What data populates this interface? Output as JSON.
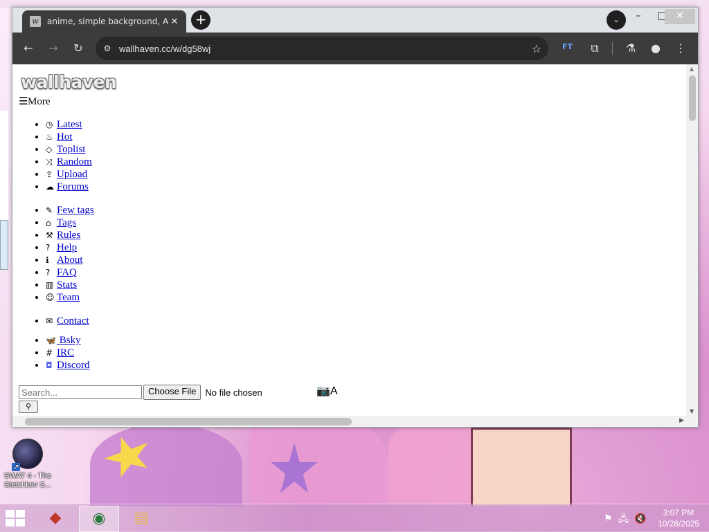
{
  "browser": {
    "tab_title": "anime, simple background, Asta",
    "tab_favicon": "wallhaven-favicon",
    "url": "wallhaven.cc/w/dg58wj",
    "extension_label": "FT"
  },
  "page": {
    "logo": "wallhaven",
    "more_label": "More",
    "nav_main": [
      {
        "icon": "clock-icon",
        "glyph": "◷",
        "label": "Latest"
      },
      {
        "icon": "flame-icon",
        "glyph": "♨",
        "label": "Hot"
      },
      {
        "icon": "diamond-icon",
        "glyph": "◇",
        "label": "Toplist"
      },
      {
        "icon": "shuffle-icon",
        "glyph": "⤨",
        "label": "Random"
      },
      {
        "icon": "upload-icon",
        "glyph": "⇪",
        "label": "Upload"
      },
      {
        "icon": "forums-icon",
        "glyph": "☁",
        "label": "Forums"
      }
    ],
    "nav_info": [
      {
        "icon": "tag-edit-icon",
        "glyph": "✎",
        "label": "Few tags"
      },
      {
        "icon": "tags-icon",
        "glyph": "⌂",
        "label": "Tags"
      },
      {
        "icon": "gavel-icon",
        "glyph": "⚒",
        "label": "Rules"
      },
      {
        "icon": "help-icon",
        "glyph": "?",
        "label": "Help"
      },
      {
        "icon": "info-icon",
        "glyph": "ℹ",
        "label": "About"
      },
      {
        "icon": "faq-icon",
        "glyph": "?",
        "label": "FAQ"
      },
      {
        "icon": "stats-icon",
        "glyph": "▥",
        "label": "Stats"
      },
      {
        "icon": "team-icon",
        "glyph": "☺",
        "label": "Team"
      }
    ],
    "nav_contact": [
      {
        "icon": "mail-icon",
        "glyph": "✉",
        "label": "Contact"
      }
    ],
    "nav_social": [
      {
        "icon": "bluesky-icon",
        "glyph": "🦋",
        "label": " Bsky"
      },
      {
        "icon": "irc-icon",
        "glyph": "#",
        "label": "IRC"
      },
      {
        "icon": "discord-icon",
        "glyph": "◘",
        "label": "Discord"
      }
    ],
    "search_placeholder": "Search...",
    "choose_file_label": "Choose File",
    "no_file_text": "No file chosen",
    "camera_text_label": "A"
  },
  "desktop": {
    "icon_label": "SWAT 4 - The Stetchkov S..."
  },
  "taskbar": {
    "time": "3:07 PM",
    "date": "10/28/2025"
  }
}
